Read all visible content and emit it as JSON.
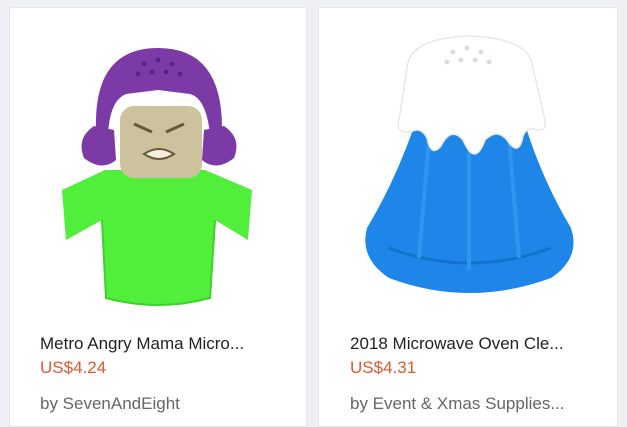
{
  "products": [
    {
      "title": "Metro Angry Mama Micro...",
      "price": "US$4.24",
      "seller": "by SevenAndEight",
      "image_icon": "angry-mama-cleaner-icon",
      "colors": {
        "hair": "#7b3aa6",
        "body": "#52ee3c",
        "face": "#ccc39e"
      }
    },
    {
      "title": "2018 Microwave Oven Cle...",
      "price": "US$4.31",
      "seller": "by Event & Xmas Supplies...",
      "image_icon": "volcano-cleaner-icon",
      "colors": {
        "snowcap": "#ffffff",
        "mountain": "#1d86e8"
      }
    }
  ],
  "price_color": "#e4572e"
}
